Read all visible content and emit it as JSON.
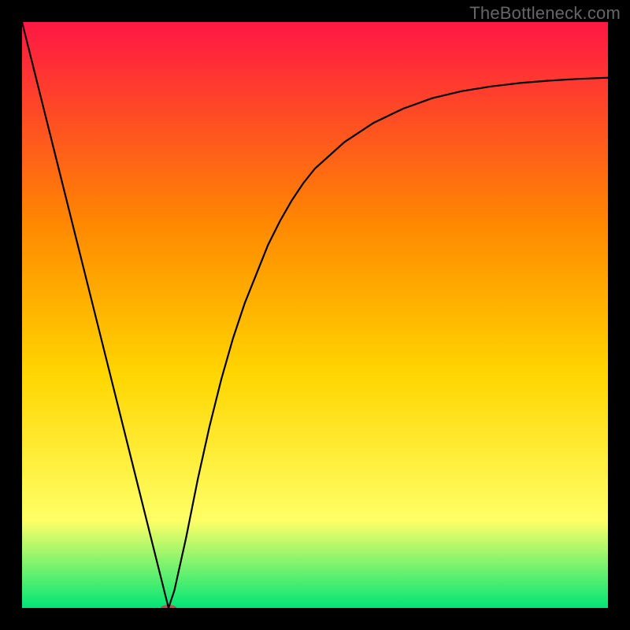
{
  "watermark": "TheBottleneck.com",
  "chart_data": {
    "type": "line",
    "title": "",
    "xlabel": "",
    "ylabel": "",
    "xlim": [
      0,
      100
    ],
    "ylim": [
      0,
      100
    ],
    "grid": false,
    "legend": false,
    "gradient_colors": {
      "top": "#ff1744",
      "mid_upper": "#ff8a00",
      "mid": "#ffd600",
      "mid_lower": "#ffff66",
      "bottom": "#00e676"
    },
    "series": [
      {
        "name": "bottleneck-curve",
        "type": "line",
        "stroke": "#000000",
        "stroke_width": 2.2,
        "x": [
          0,
          2,
          4,
          6,
          8,
          10,
          12,
          14,
          16,
          18,
          20,
          22,
          24,
          25,
          26,
          28,
          30,
          32,
          34,
          36,
          38,
          40,
          42,
          44,
          46,
          48,
          50,
          55,
          60,
          65,
          70,
          75,
          80,
          85,
          90,
          95,
          100
        ],
        "y": [
          100,
          92,
          84,
          76,
          68,
          60,
          52,
          44,
          36,
          28,
          20,
          12,
          4,
          0,
          3,
          12,
          22,
          31,
          39,
          46,
          52,
          57,
          62,
          66,
          69.5,
          72.5,
          75,
          79.5,
          82.8,
          85.2,
          87,
          88.2,
          89,
          89.6,
          90,
          90.3,
          90.5
        ]
      },
      {
        "name": "min-marker",
        "type": "marker",
        "fill": "#c05050",
        "x": 25,
        "y": 0,
        "rx": 10,
        "ry": 4
      }
    ]
  }
}
